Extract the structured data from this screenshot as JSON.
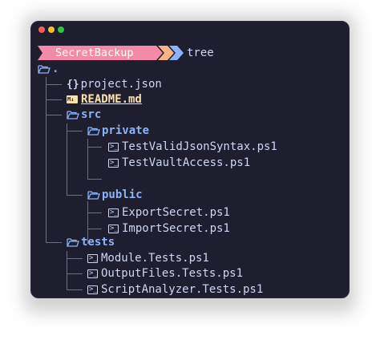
{
  "prompt": {
    "directory": "SecretBackup",
    "command": "tree"
  },
  "tree": {
    "root": ".",
    "entries": [
      {
        "name": "project.json",
        "kind": "json"
      },
      {
        "name": "README.md",
        "kind": "markdown"
      },
      {
        "name": "src",
        "kind": "folder"
      },
      {
        "name": "private",
        "kind": "folder"
      },
      {
        "name": "TestValidJsonSyntax.ps1",
        "kind": "powershell"
      },
      {
        "name": "TestVaultAccess.ps1",
        "kind": "powershell"
      },
      {
        "name": "public",
        "kind": "folder"
      },
      {
        "name": "ExportSecret.ps1",
        "kind": "powershell"
      },
      {
        "name": "ImportSecret.ps1",
        "kind": "powershell"
      },
      {
        "name": "tests",
        "kind": "folder"
      },
      {
        "name": "Module.Tests.ps1",
        "kind": "powershell"
      },
      {
        "name": "OutputFiles.Tests.ps1",
        "kind": "powershell"
      },
      {
        "name": "ScriptAnalyzer.Tests.ps1",
        "kind": "powershell"
      }
    ]
  },
  "colors": {
    "background": "#1e1e2e",
    "text": "#cdd6f4",
    "folder": "#89b4fa",
    "readme": "#f9e2af",
    "prompt_pink": "#f38ba8",
    "prompt_orange": "#fab387",
    "prompt_blue": "#89b4fa"
  }
}
